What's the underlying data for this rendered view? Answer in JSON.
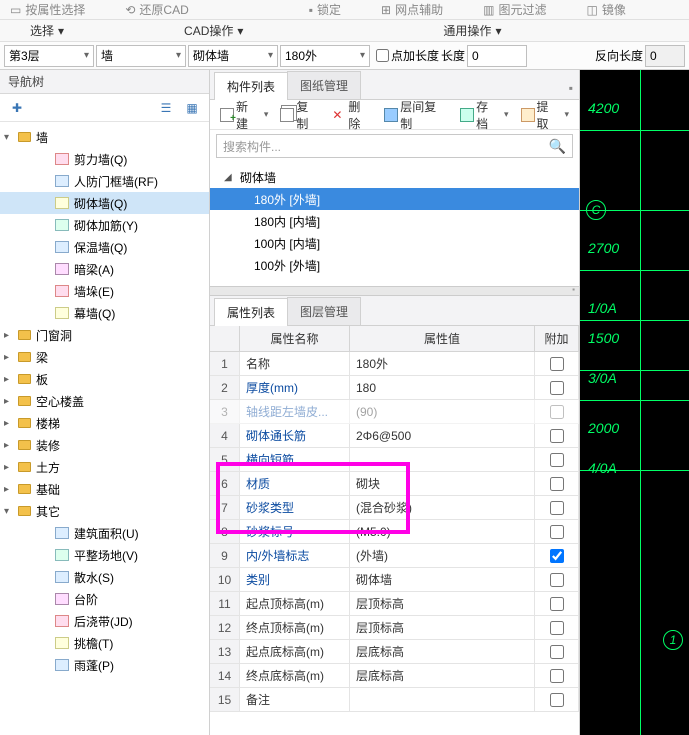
{
  "ribbon": {
    "r1": {
      "a": "按属性选择",
      "b": "还原CAD",
      "c": "锁定",
      "d": "网点辅助",
      "e": "图元过滤",
      "f": "镜像"
    },
    "r2": {
      "sel": "选择",
      "selCaret": "▾",
      "cad": "CAD操作",
      "cadCaret": "▾",
      "common": "通用操作",
      "commonCaret": "▾"
    }
  },
  "selectors": {
    "floor": "第3层",
    "cat": "墙",
    "sub": "砌体墙",
    "item": "180外",
    "pointLen": "点加长度",
    "lenLbl": "长度",
    "lenVal": "0",
    "revLen": "反向长度",
    "revLenVal": "0"
  },
  "navTree": {
    "title": "导航树",
    "wall": "墙",
    "wallChildren": [
      {
        "label": "剪力墙(Q)",
        "ic": "c1"
      },
      {
        "label": "人防门框墙(RF)",
        "ic": "c5"
      },
      {
        "label": "砌体墙(Q)",
        "ic": "c3",
        "selected": true
      },
      {
        "label": "砌体加筋(Y)",
        "ic": "c2"
      },
      {
        "label": "保温墙(Q)",
        "ic": "c5"
      },
      {
        "label": "暗梁(A)",
        "ic": "c4"
      },
      {
        "label": "墙垛(E)",
        "ic": "c1"
      },
      {
        "label": "幕墙(Q)",
        "ic": "c3"
      }
    ],
    "siblings": [
      "门窗洞",
      "梁",
      "板",
      "空心楼盖",
      "楼梯",
      "装修",
      "土方",
      "基础"
    ],
    "other": "其它",
    "otherChildren": [
      {
        "label": "建筑面积(U)",
        "ic": "c5"
      },
      {
        "label": "平整场地(V)",
        "ic": "c2"
      },
      {
        "label": "散水(S)",
        "ic": "c5"
      },
      {
        "label": "台阶",
        "ic": "c4"
      },
      {
        "label": "后浇带(JD)",
        "ic": "c1"
      },
      {
        "label": "挑檐(T)",
        "ic": "c3"
      },
      {
        "label": "雨蓬(P)",
        "ic": "c5"
      }
    ]
  },
  "compList": {
    "tab1": "构件列表",
    "tab2": "图纸管理",
    "tbNew": "新建",
    "tbCopy": "复制",
    "tbDel": "删除",
    "tbLayer": "层间复制",
    "tbSave": "存档",
    "tbExtract": "提取",
    "searchPh": "搜索构件...",
    "root": "砌体墙",
    "items": [
      {
        "label": "180外 [外墙]",
        "selected": true
      },
      {
        "label": "180内 [内墙]"
      },
      {
        "label": "100内 [内墙]"
      },
      {
        "label": "100外 [外墙]"
      }
    ]
  },
  "propList": {
    "tab1": "属性列表",
    "tab2": "图层管理",
    "colName": "属性名称",
    "colVal": "属性值",
    "colAdd": "附加",
    "rows": [
      {
        "n": "1",
        "name": "名称",
        "val": "180外",
        "black": true
      },
      {
        "n": "2",
        "name": "厚度(mm)",
        "val": "180",
        "link": true
      },
      {
        "n": "3",
        "name": "轴线距左墙皮...",
        "val": "(90)",
        "link": true,
        "hidden": true
      },
      {
        "n": "4",
        "name": "砌体通长筋",
        "val": "2Φ6@500",
        "link": true
      },
      {
        "n": "5",
        "name": "横向短筋",
        "val": "",
        "link": true
      },
      {
        "n": "6",
        "name": "材质",
        "val": "砌块",
        "link": true,
        "partial": true
      },
      {
        "n": "7",
        "name": "砂浆类型",
        "val": "(混合砂浆)",
        "link": true
      },
      {
        "n": "8",
        "name": "砂浆标号",
        "val": "(M5.0)",
        "link": true
      },
      {
        "n": "9",
        "name": "内/外墙标志",
        "val": "(外墙)",
        "link": true,
        "checked": true
      },
      {
        "n": "10",
        "name": "类别",
        "val": "砌体墙",
        "link": true
      },
      {
        "n": "11",
        "name": "起点顶标高(m)",
        "val": "层顶标高",
        "black": true
      },
      {
        "n": "12",
        "name": "终点顶标高(m)",
        "val": "层顶标高",
        "black": true
      },
      {
        "n": "13",
        "name": "起点底标高(m)",
        "val": "层底标高",
        "black": true
      },
      {
        "n": "14",
        "name": "终点底标高(m)",
        "val": "层底标高",
        "black": true
      },
      {
        "n": "15",
        "name": "备注",
        "val": "",
        "black": true
      }
    ]
  },
  "canvas": {
    "labels": [
      "4200",
      "2700",
      "1/0A",
      "1500",
      "3/0A",
      "2000",
      "4/0A"
    ],
    "circC": "C",
    "circ1": "1"
  }
}
